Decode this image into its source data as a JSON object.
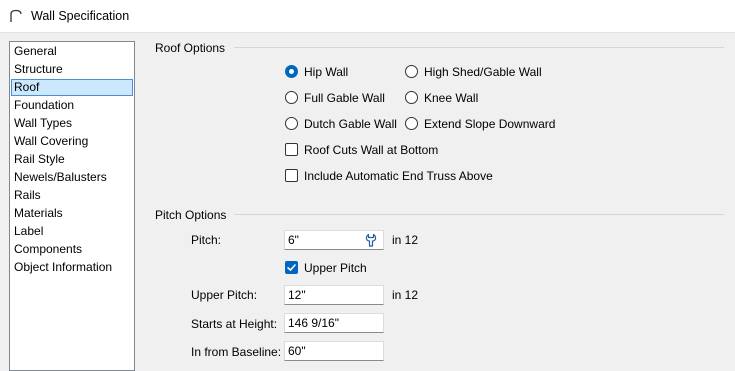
{
  "window": {
    "title": "Wall Specification",
    "icon": "arch-wall-icon"
  },
  "sidebar": {
    "items": [
      {
        "label": "General",
        "selected": false
      },
      {
        "label": "Structure",
        "selected": false
      },
      {
        "label": "Roof",
        "selected": true
      },
      {
        "label": "Foundation",
        "selected": false
      },
      {
        "label": "Wall Types",
        "selected": false
      },
      {
        "label": "Wall Covering",
        "selected": false
      },
      {
        "label": "Rail Style",
        "selected": false
      },
      {
        "label": "Newels/Balusters",
        "selected": false
      },
      {
        "label": "Rails",
        "selected": false
      },
      {
        "label": "Materials",
        "selected": false
      },
      {
        "label": "Label",
        "selected": false
      },
      {
        "label": "Components",
        "selected": false
      },
      {
        "label": "Object Information",
        "selected": false
      }
    ]
  },
  "roof_options": {
    "title": "Roof Options",
    "hip_wall": {
      "label": "Hip Wall",
      "checked": true
    },
    "high_shed_gable_wall": {
      "label": "High Shed/Gable Wall",
      "checked": false
    },
    "full_gable_wall": {
      "label": "Full Gable Wall",
      "checked": false
    },
    "knee_wall": {
      "label": "Knee Wall",
      "checked": false
    },
    "dutch_gable_wall": {
      "label": "Dutch Gable Wall",
      "checked": false
    },
    "extend_slope_downward": {
      "label": "Extend Slope Downward",
      "checked": false
    },
    "roof_cuts_wall": {
      "label": "Roof Cuts Wall at Bottom",
      "checked": false
    },
    "include_end_truss": {
      "label": "Include Automatic End Truss Above",
      "checked": false
    }
  },
  "pitch_options": {
    "title": "Pitch Options",
    "pitch": {
      "label": "Pitch:",
      "value": "6\"",
      "unit": "in 12"
    },
    "upper_pitch_checkbox": {
      "label": "Upper Pitch",
      "checked": true
    },
    "upper_pitch": {
      "label": "Upper Pitch:",
      "value": "12\"",
      "unit": "in 12"
    },
    "starts_at_height": {
      "label": "Starts at Height:",
      "value": "146 9/16\""
    },
    "in_from_baseline": {
      "label": "In from Baseline:",
      "value": "60\""
    }
  },
  "colors": {
    "accent": "#0067c0",
    "selection_fill": "#cce8ff",
    "selection_border": "#4d8fd1",
    "dialog_bg": "#f0f0f0"
  }
}
